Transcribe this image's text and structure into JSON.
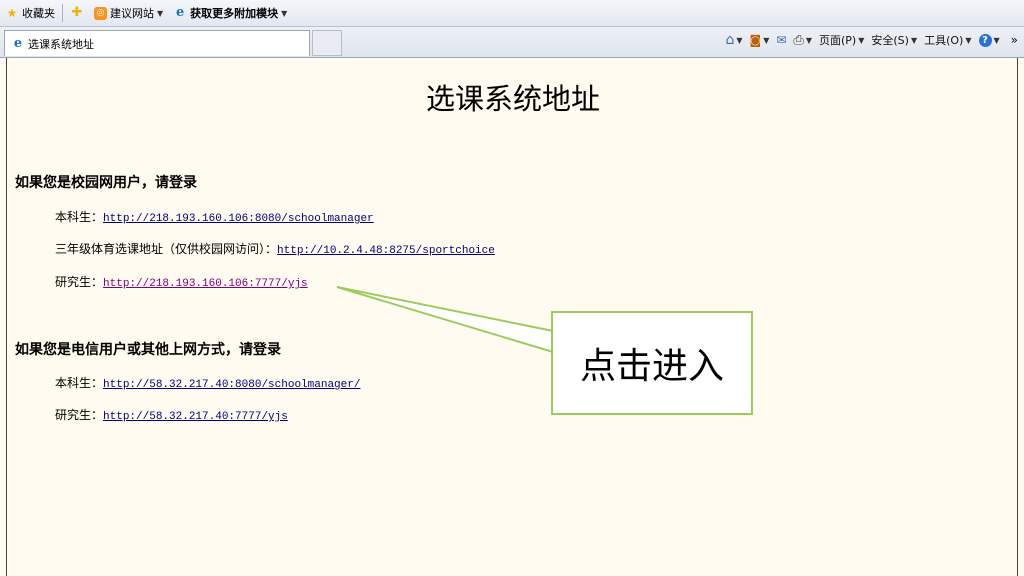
{
  "favbar": {
    "favorites": "收藏夹",
    "suggested": "建议网站",
    "addons": "获取更多附加模块"
  },
  "tab": {
    "title": "选课系统地址"
  },
  "command": {
    "page": "页面(P)",
    "safety": "安全(S)",
    "tools": "工具(O)"
  },
  "page": {
    "title": "选课系统地址",
    "section1": {
      "heading": "如果您是校园网用户，请登录",
      "rows": [
        {
          "label": "本科生：",
          "link": "http://218.193.160.106:8080/schoolmanager"
        },
        {
          "label": "三年级体育选课地址（仅供校园网访问）：",
          "link": "http://10.2.4.48:8275/sportchoice"
        },
        {
          "label": "研究生：",
          "link": "http://218.193.160.106:7777/yjs"
        }
      ]
    },
    "section2": {
      "heading": "如果您是电信用户或其他上网方式，请登录",
      "rows": [
        {
          "label": "本科生：",
          "link": "http://58.32.217.40:8080/schoolmanager/"
        },
        {
          "label": "研究生：",
          "link": "http://58.32.217.40:7777/yjs"
        }
      ]
    }
  },
  "callout": {
    "text": "点击进入",
    "border_color": "#9acd5c"
  }
}
